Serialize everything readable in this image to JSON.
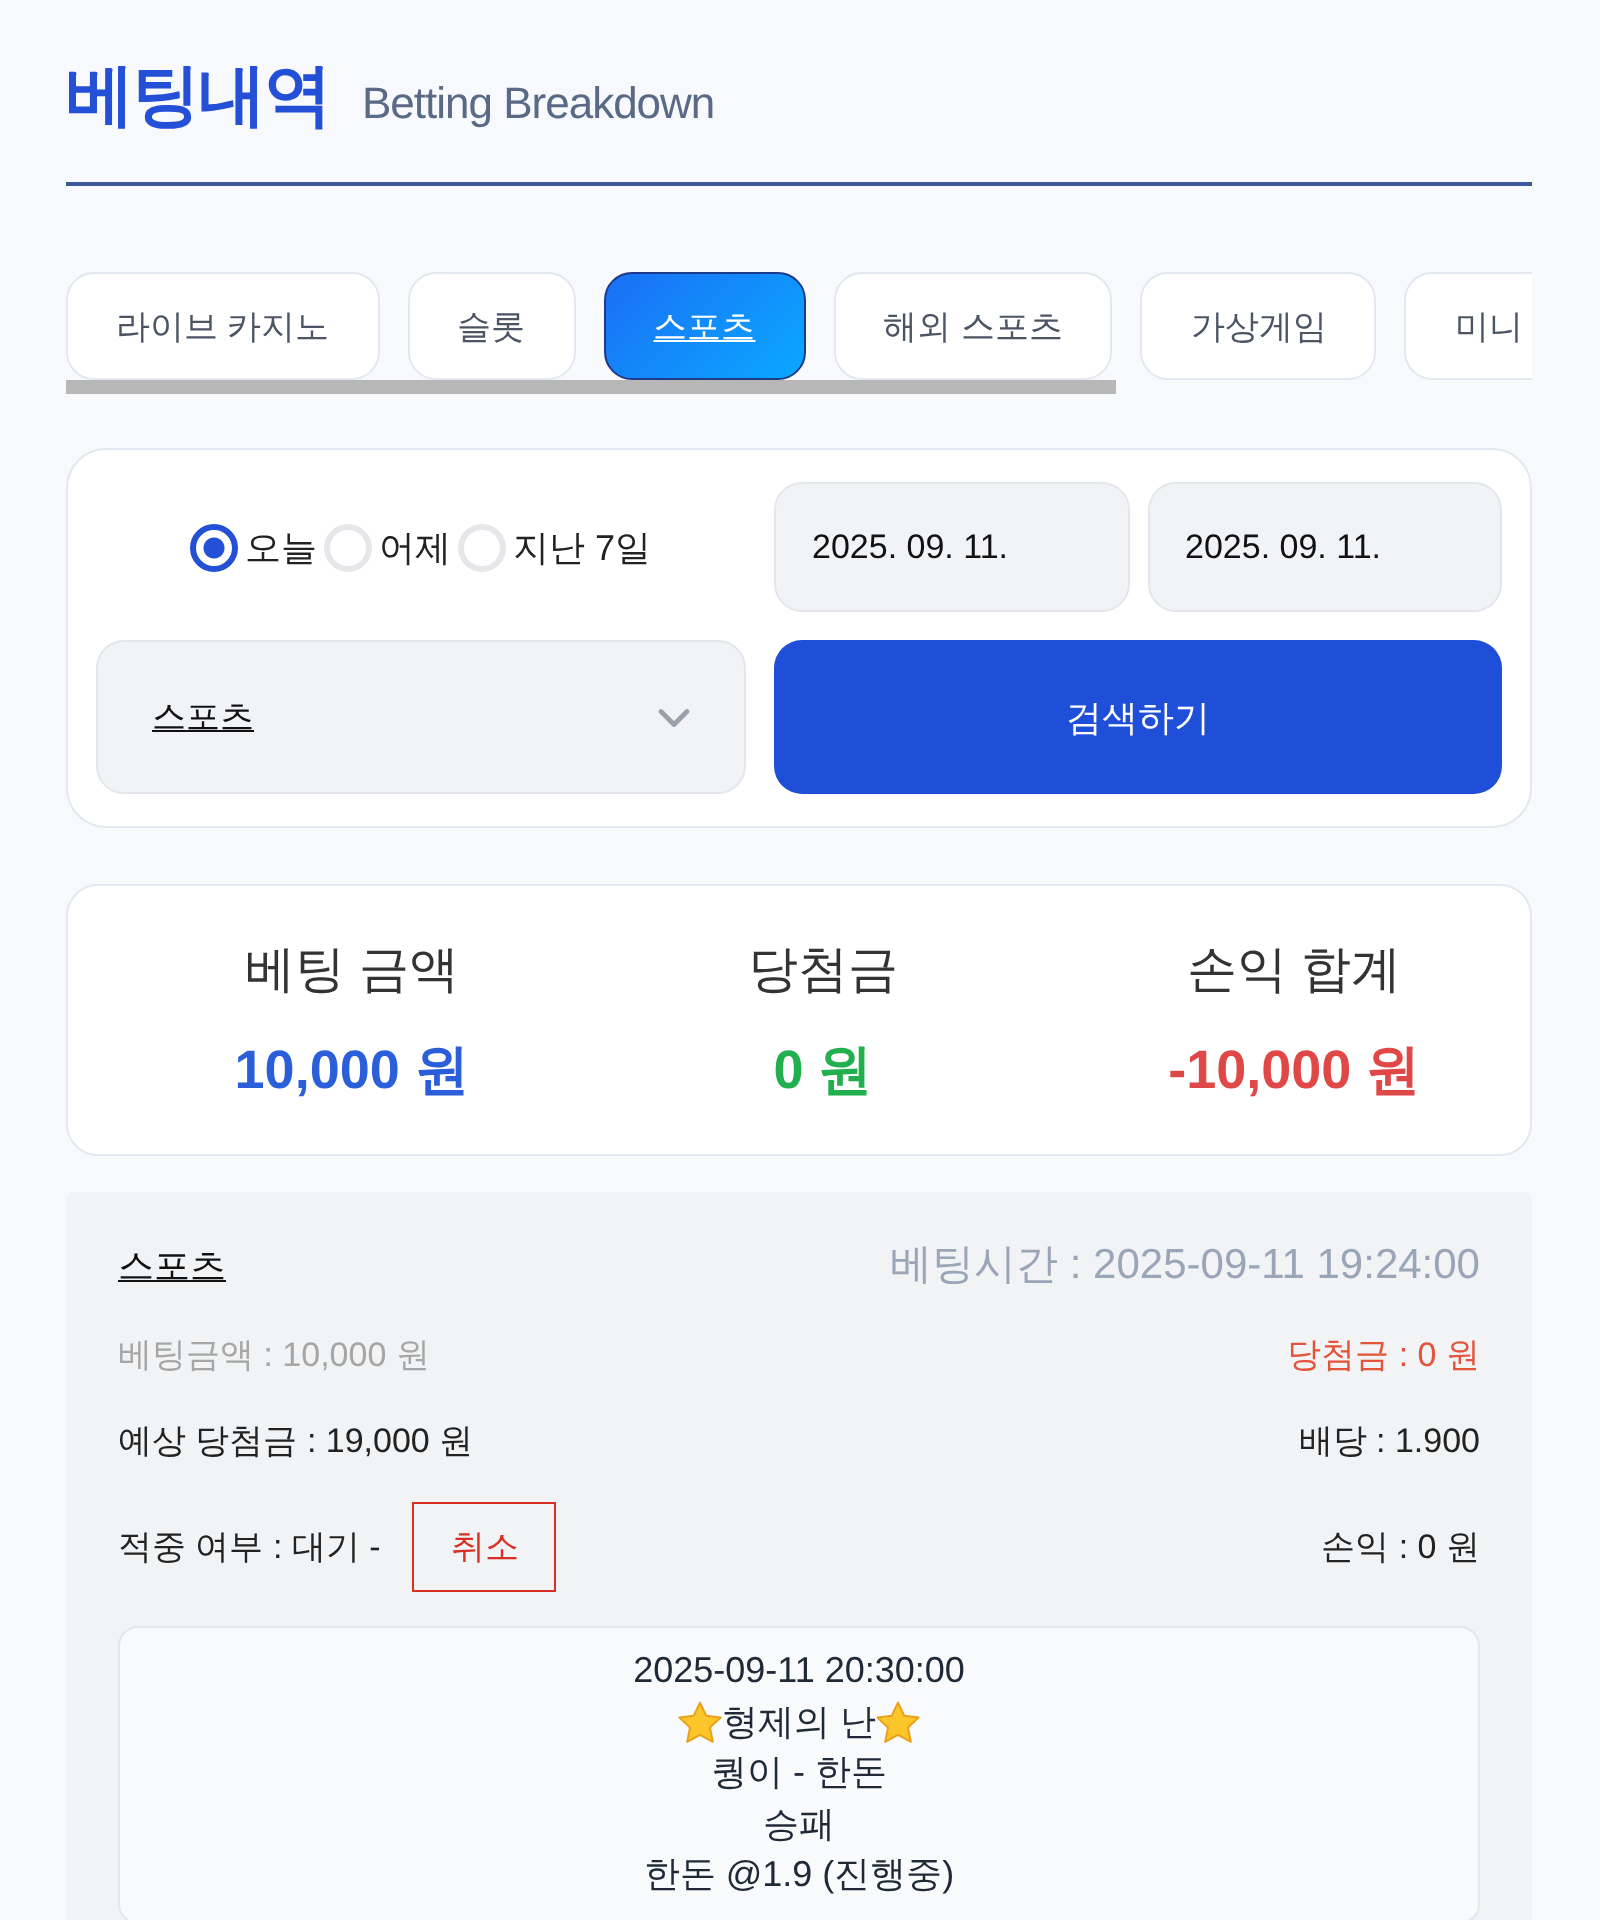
{
  "header": {
    "title": "베팅내역",
    "subtitle": "Betting Breakdown"
  },
  "tabs": [
    {
      "label": "라이브 카지노",
      "selected": false
    },
    {
      "label": "슬롯",
      "selected": false
    },
    {
      "label": "스포츠",
      "selected": true
    },
    {
      "label": "해외 스포츠",
      "selected": false
    },
    {
      "label": "가상게임",
      "selected": false
    },
    {
      "label": "미니",
      "selected": false
    }
  ],
  "filter": {
    "periods": [
      {
        "label": "오늘",
        "selected": true
      },
      {
        "label": "어제",
        "selected": false
      },
      {
        "label": "지난 7일",
        "selected": false
      }
    ],
    "date_from": "2025. 09. 11.",
    "date_to": "2025. 09. 11.",
    "category": "스포츠",
    "search_button": "검색하기"
  },
  "summary": [
    {
      "label": "베팅 금액",
      "value": "10,000 원",
      "color": "#2b5fd9"
    },
    {
      "label": "당첨금",
      "value": "0 원",
      "color": "#22b04e"
    },
    {
      "label": "손익 합계",
      "value": "-10,000 원",
      "color": "#e04848"
    }
  ],
  "bets": [
    {
      "category": "스포츠",
      "bet_time": "베팅시간 : 2025-09-11 19:24:00",
      "stake": "베팅금액 : 10,000 원",
      "winnings": "당첨금 : 0 원",
      "expected": "예상 당첨금 : 19,000 원",
      "odds": "배당 : 1.900",
      "result": "적중 여부 : 대기 -",
      "cancel_button": "취소",
      "profit": "손익 : 0 원",
      "details": [
        {
          "kind": "plain",
          "text": "2025-09-11 20:30:00"
        },
        {
          "kind": "starred",
          "text": "형제의 난"
        },
        {
          "kind": "plain",
          "text": "퀑이 - 한돈"
        },
        {
          "kind": "plain",
          "text": "승패"
        },
        {
          "kind": "plain",
          "text": "한돈 @1.9 (진행중)"
        }
      ]
    }
  ]
}
